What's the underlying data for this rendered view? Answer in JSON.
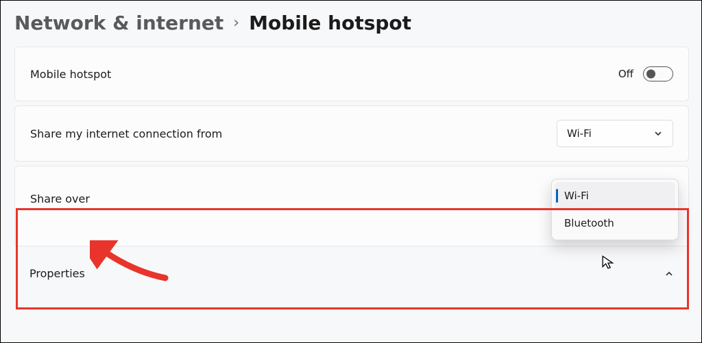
{
  "breadcrumb": {
    "parent": "Network & internet",
    "sep": "›",
    "current": "Mobile hotspot"
  },
  "rows": {
    "hotspot_toggle": {
      "label": "Mobile hotspot",
      "state": "Off"
    },
    "share_from": {
      "label": "Share my internet connection from",
      "value": "Wi-Fi"
    },
    "share_over": {
      "label": "Share over",
      "menu": {
        "opt1": "Wi-Fi",
        "opt2": "Bluetooth"
      }
    },
    "properties": {
      "label": "Properties"
    }
  },
  "annotation": {
    "highlight_color": "#e8342a"
  }
}
